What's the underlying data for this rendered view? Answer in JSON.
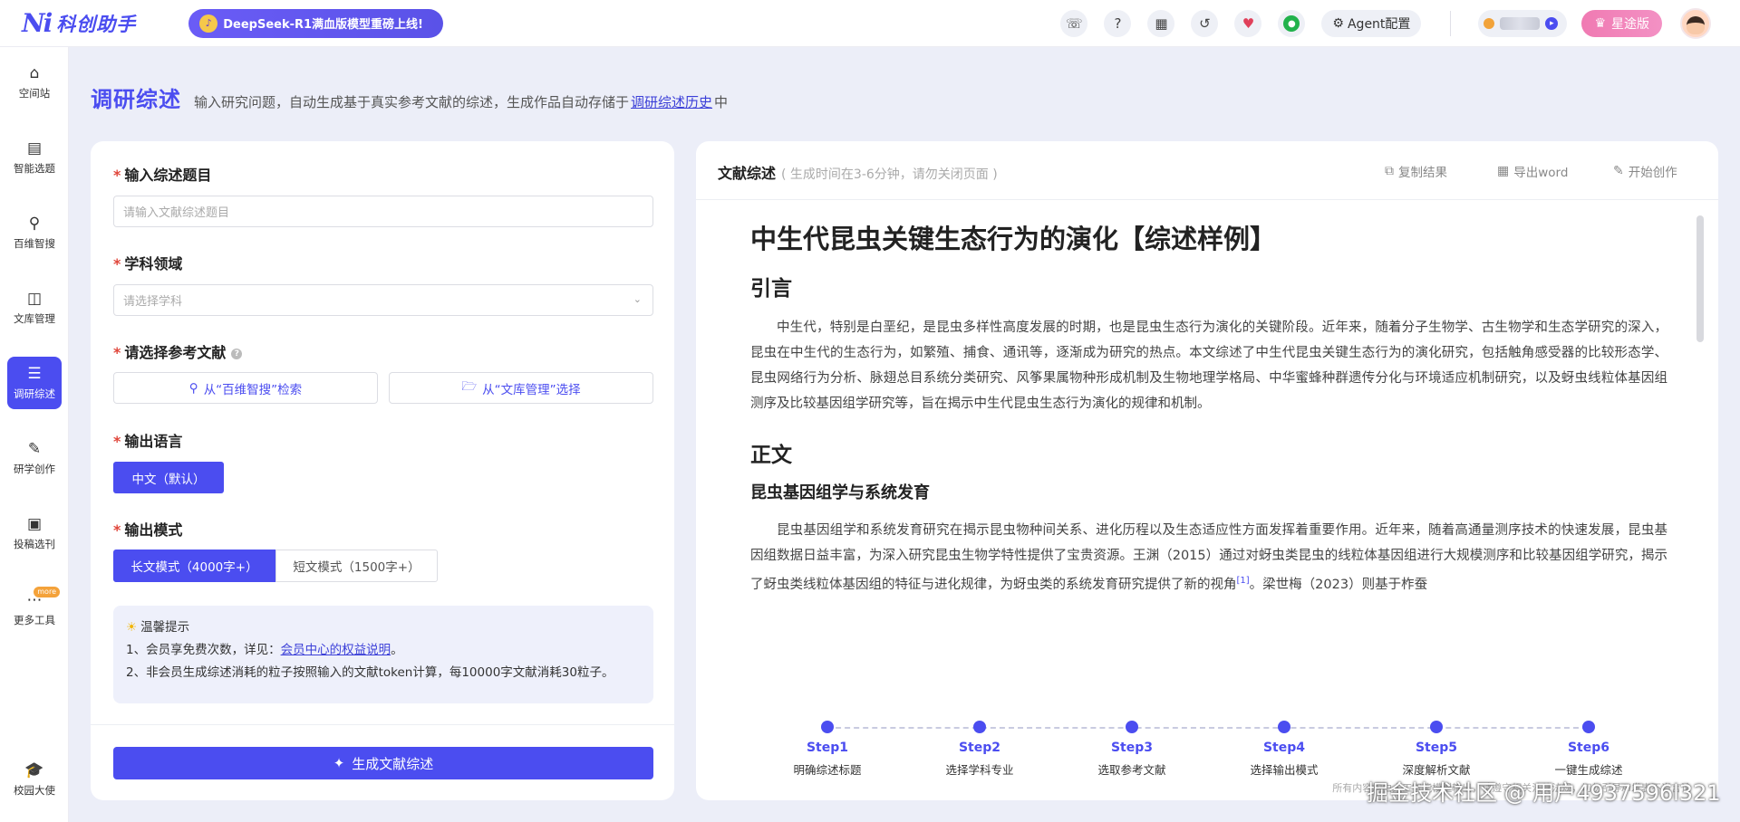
{
  "brand": {
    "name": "科创助手",
    "promo": "DeepSeek-R1满血版模型重磅上线!"
  },
  "topbar": {
    "agent_label": "Agent配置",
    "vip_label": "星途版"
  },
  "sidebar": {
    "items": [
      {
        "label": "空间站"
      },
      {
        "label": "智能选题"
      },
      {
        "label": "百维智搜"
      },
      {
        "label": "文库管理"
      },
      {
        "label": "调研综述"
      },
      {
        "label": "研学创作"
      },
      {
        "label": "投稿选刊"
      },
      {
        "label": "更多工具",
        "badge": "more"
      }
    ],
    "bottom": {
      "label": "校园大使"
    }
  },
  "header": {
    "title": "调研综述",
    "desc_before": "输入研究问题，自动生成基于真实参考文献的综述，生成作品自动存储于",
    "desc_link": "调研综述历史",
    "desc_after": "中"
  },
  "form": {
    "topic_label": "输入综述题目",
    "topic_placeholder": "请输入文献综述题目",
    "subject_label": "学科领域",
    "subject_placeholder": "请选择学科",
    "refs_label": "请选择参考文献",
    "ref_search_btn": "从“百维智搜”检索",
    "ref_library_btn": "从“文库管理”选择",
    "lang_label": "输出语言",
    "lang_option": "中文（默认）",
    "mode_label": "输出模式",
    "mode_long": "长文模式（4000字+）",
    "mode_short": "短文模式（1500字+）",
    "tips_title": "温馨提示",
    "tip1_before": "1、会员享免费次数，详见：",
    "tip1_link": "会员中心的权益说明",
    "tip1_after": "。",
    "tip2": "2、非会员生成综述消耗的粒子按照输入的文献token计算，每10000字文献消耗30粒子。",
    "generate_btn": "生成文献综述"
  },
  "result": {
    "title": "文献综述",
    "subtitle": "( 生成时间在3-6分钟，请勿关闭页面 )",
    "copy_btn": "复制结果",
    "export_btn": "导出word",
    "create_btn": "开始创作",
    "doc": {
      "title": "中生代昆虫关键生态行为的演化【综述样例】",
      "intro_heading": "引言",
      "intro_text": "中生代，特别是白垩纪，是昆虫多样性高度发展的时期，也是昆虫生态行为演化的关键阶段。近年来，随着分子生物学、古生物学和生态学研究的深入，昆虫在中生代的生态行为，如繁殖、捕食、通讯等，逐渐成为研究的热点。本文综述了中生代昆虫关键生态行为的演化研究，包括触角感受器的比较形态学、昆虫网络行为分析、脉翅总目系统分类研究、风筝果属物种形成机制及生物地理学格局、中华蜜蜂种群遗传分化与环境适应机制研究，以及蚜虫线粒体基因组测序及比较基因组学研究等，旨在揭示中生代昆虫生态行为演化的规律和机制。",
      "body_heading": "正文",
      "section_heading": "昆虫基因组学与系统发育",
      "section_text_1": "昆虫基因组学和系统发育研究在揭示昆虫物种间关系、进化历程以及生态适应性方面发挥着重要作用。近年来，随着高通量测序技术的快速发展，昆虫基因组数据日益丰富，为深入研究昆虫生物学特性提供了宝贵资源。王渊（2015）通过对蚜虫类昆虫的线粒体基因组进行大规模测序和比较基因组学研究，揭示了蚜虫类线粒体基因组的特征与进化规律，为蚜虫类的系统发育研究提供了新的视角",
      "cite": "[1]",
      "section_text_2": "。梁世梅（2023）则基于柞蚕"
    },
    "steps": [
      {
        "num": "Step1",
        "desc": "明确综述标题"
      },
      {
        "num": "Step2",
        "desc": "选择学科专业"
      },
      {
        "num": "Step3",
        "desc": "选取参考文献"
      },
      {
        "num": "Step4",
        "desc": "选择输出模式"
      },
      {
        "num": "Step5",
        "desc": "深度解析文献"
      },
      {
        "num": "Step6",
        "desc": "一键生成综述"
      }
    ],
    "footnote": "所有内容均由人工智能模型输出，请遵守相关法律法规，切勿引导AI发表不当言论"
  },
  "watermark": "掘金技术社区 @ 用户4937596l321",
  "colors": {
    "accent": "#4b4df0",
    "vip": "#f07ab2",
    "bg": "#eceef8"
  },
  "icons": [
    "headset-icon",
    "question-icon",
    "calendar-icon",
    "history-icon",
    "heart-pulse-icon",
    "wechat-icon",
    "gear-icon",
    "crown-icon"
  ]
}
